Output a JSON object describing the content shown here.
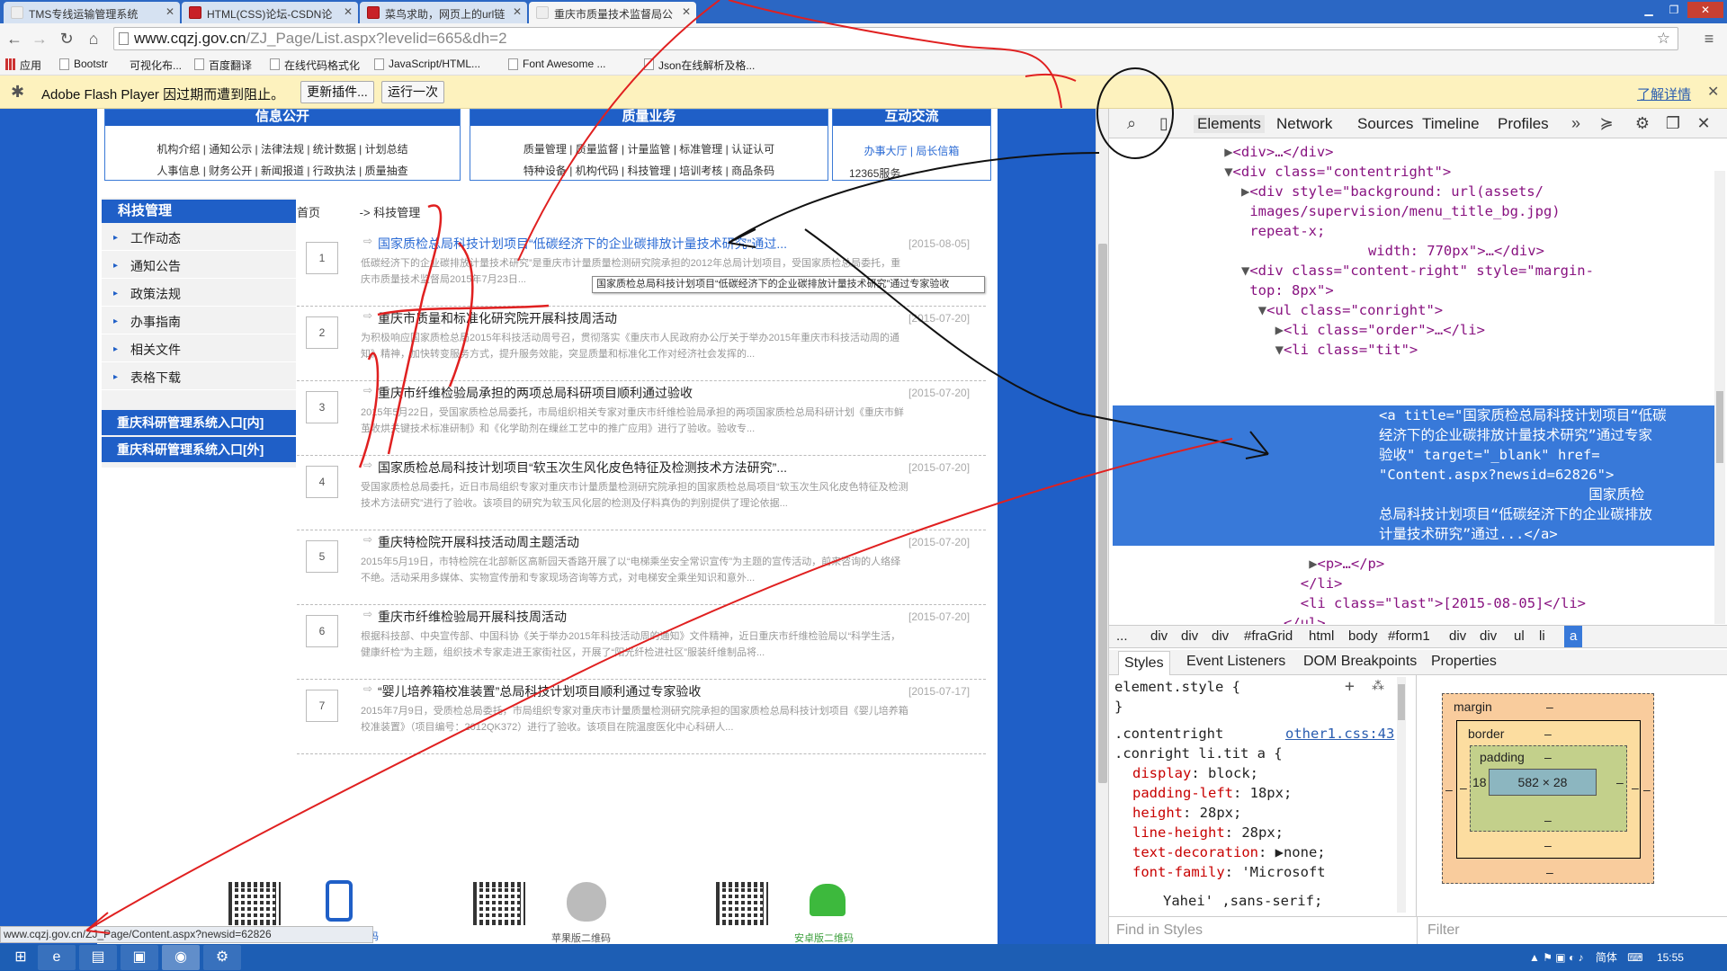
{
  "tabs": [
    {
      "label": "TMS专线运输管理系统",
      "favicon": "page"
    },
    {
      "label": "HTML(CSS)论坛-CSDN论",
      "favicon": "csdn"
    },
    {
      "label": "菜鸟求助，网页上的url链",
      "favicon": "csdn"
    },
    {
      "label": "重庆市质量技术监督局公",
      "favicon": "page"
    }
  ],
  "address": {
    "host": "www.cqzj.gov.cn",
    "path": "/ZJ_Page/List.aspx?levelid=665&dh=2"
  },
  "bookmarks": [
    "应用",
    "Bootstr",
    "可视化布...",
    "百度翻译",
    "在线代码格式化",
    "JavaScript/HTML...",
    "Font Awesome ...",
    "Json在线解析及格..."
  ],
  "flash": {
    "message": "Adobe Flash Player 因过期而遭到阻止。",
    "update_label": "更新插件...",
    "run_label": "运行一次",
    "details_label": "了解详情"
  },
  "page": {
    "boxes": [
      {
        "title": "信息公开",
        "row1": "机构介绍 | 通知公示 | 法律法规 | 统计数据 | 计划总结",
        "row2": "人事信息 | 财务公开 | 新闻报道 | 行政执法 | 质量抽查"
      },
      {
        "title": "质量业务",
        "row1": "质量管理 | 质量监督 | 计量监管 | 标准管理 | 认证认可",
        "row2": "特种设备 | 机构代码 | 科技管理 | 培训考核 | 商品条码"
      },
      {
        "title": "互动交流",
        "row1": "办事大厅 | 局长信箱",
        "row2": "12365服务"
      }
    ],
    "sidebar": {
      "title": "科技管理",
      "items": [
        "工作动态",
        "通知公告",
        "政策法规",
        "办事指南",
        "相关文件",
        "表格下载"
      ],
      "links": [
        "重庆科研管理系统入口[内]",
        "重庆科研管理系统入口[外]"
      ]
    },
    "breadcrumb": {
      "home": "首页",
      "sep": "->",
      "current": "科技管理"
    },
    "articles": [
      {
        "num": "1",
        "title": "国家质检总局科技计划项目“低碳经济下的企业碳排放计量技术研究”通过...",
        "date": "[2015-08-05]",
        "desc": "低碳经济下的企业碳排放计量技术研究”是重庆市计量质量检测研究院承担的2012年总局计划项目，受国家质检总局委托，重庆市质量技术监督局2015年7月23日..."
      },
      {
        "num": "2",
        "title": "重庆市质量和标准化研究院开展科技周活动",
        "date": "[2015-07-20]",
        "desc": "为积极响应国家质检总局2015年科技活动周号召，贯彻落实《重庆市人民政府办公厅关于举办2015年重庆市科技活动周的通知》精神，加快转变服务方式，提升服务效能，突显质量和标准化工作对经济社会发挥的..."
      },
      {
        "num": "3",
        "title": "重庆市纤维检验局承担的两项总局科研项目顺利通过验收",
        "date": "[2015-07-20]",
        "desc": "2015年5月22日，受国家质检总局委托，市局组织相关专家对重庆市纤维检验局承担的两项国家质检总局科研计划《重庆市鲜茧收烘关键技术标准研制》和《化学助剂在缫丝工艺中的推广应用》进行了验收。验收专..."
      },
      {
        "num": "4",
        "title": "国家质检总局科技计划项目“软玉次生风化皮色特征及检测技术方法研究”...",
        "date": "[2015-07-20]",
        "desc": "受国家质检总局委托，近日市局组织专家对重庆市计量质量检测研究院承担的国家质检总局项目“软玉次生风化皮色特征及检测技术方法研究”进行了验收。该项目的研究为软玉风化层的检测及仔料真伪的判别提供了理论依据..."
      },
      {
        "num": "5",
        "title": "重庆特检院开展科技活动周主题活动",
        "date": "[2015-07-20]",
        "desc": "2015年5月19日，市特检院在北部新区高新园天香路开展了以“电梯乘坐安全常识宣传”为主题的宣传活动，前来咨询的人络绎不绝。活动采用多媒体、实物宣传册和专家现场咨询等方式，对电梯安全乘坐知识和意外..."
      },
      {
        "num": "6",
        "title": "重庆市纤维检验局开展科技周活动",
        "date": "[2015-07-20]",
        "desc": "根据科技部、中央宣传部、中国科协《关于举办2015年科技活动周的通知》文件精神，近日重庆市纤维检验局以“科学生活，健康纤检”为主题，组织技术专家走进王家街社区，开展了“阳光纤检进社区”服装纤维制品将..."
      },
      {
        "num": "7",
        "title": "“婴儿培养箱校准装置”总局科技计划项目顺利通过专家验收",
        "date": "[2015-07-17]",
        "desc": "2015年7月9日，受质检总局委托，市局组织专家对重庆市计量质量检测研究院承担的国家质检总局科技计划项目《婴儿培养箱校准装置》（项目编号：2012QK372）进行了验收。该项目在院温度医化中心科研人..."
      }
    ],
    "tooltip": "国家质检总局科技计划项目“低碳经济下的企业碳排放计量技术研究”通过专家验收",
    "footer": {
      "apple_label": "苹果版二维码",
      "android_label": "安卓版二维码",
      "partial_label": "码"
    },
    "status_url": "www.cqzj.gov.cn/ZJ_Page/Content.aspx?newsid=62826"
  },
  "devtools": {
    "tabs": [
      "Elements",
      "Network",
      "Sources",
      "Timeline",
      "Profiles"
    ],
    "dom_lines": [
      {
        "indent": 13,
        "tri": "▶",
        "html": "<div>…</div>"
      },
      {
        "indent": 13,
        "tri": "▼",
        "html": "<div class=\"contentright\">"
      },
      {
        "indent": 15,
        "tri": "▶",
        "html": "<div style=\"background: url(assets/"
      },
      {
        "indent": 15,
        "tri": "",
        "html": "images/supervision/menu_title_bg.jpg)"
      },
      {
        "indent": 15,
        "tri": "",
        "html": "repeat-x;"
      },
      {
        "indent": 29,
        "tri": "",
        "html": "width: 770px\">…</div>"
      },
      {
        "indent": 15,
        "tri": "▼",
        "html": "<div class=\"content-right\" style=\"margin-"
      },
      {
        "indent": 15,
        "tri": "",
        "html": "top: 8px\">"
      },
      {
        "indent": 17,
        "tri": "▼",
        "html": "<ul class=\"conright\">"
      },
      {
        "indent": 19,
        "tri": "▶",
        "html": "<li class=\"order\">…</li>"
      },
      {
        "indent": 19,
        "tri": "▼",
        "html": "<li class=\"tit\">"
      }
    ],
    "dom_selected": "<a title=\"国家质检总局科技计划项目“低碳\n经济下的企业碳排放计量技术研究”通过专家\n验收\" target=\"_blank\" href=\n\"Content.aspx?newsid=62826\">\n                         国家质检\n总局科技计划项目“低碳经济下的企业碳排放\n计量技术研究”通过...</a>",
    "dom_after": [
      {
        "indent": 23,
        "tri": "▶",
        "html": "<p>…</p>"
      },
      {
        "indent": 21,
        "tri": "",
        "html": "</li>"
      },
      {
        "indent": 21,
        "tri": "",
        "html": "<li class=\"last\">[2015-08-05]</li>"
      },
      {
        "indent": 19,
        "tri": "",
        "html": "</ul>"
      },
      {
        "indent": 17,
        "tri": "▶",
        "html": "<ul class=\"conright\">…</ul>"
      }
    ],
    "crumbs": [
      "...",
      "div",
      "div",
      "div",
      "#fraGrid",
      "html",
      "body",
      "#form1",
      "div",
      "div",
      "ul",
      "li",
      "a"
    ],
    "subtabs": [
      "Styles",
      "Event Listeners",
      "DOM Breakpoints",
      "Properties"
    ],
    "styles": {
      "element_style": "element.style {",
      "close": "}",
      "selector1": ".contentright",
      "link": "other1.css:43",
      "selector2": ".conright li.tit a {",
      "props": [
        {
          "name": "display",
          "value": "block;"
        },
        {
          "name": "padding-left",
          "value": "18px;"
        },
        {
          "name": "height",
          "value": "28px;"
        },
        {
          "name": "line-height",
          "value": "28px;"
        },
        {
          "name": "text-decoration",
          "value": "▶none;"
        },
        {
          "name": "font-family",
          "value": "'Microsoft"
        }
      ],
      "cont": "Yahei' ,sans-serif;",
      "find_placeholder": "Find in Styles",
      "filter_placeholder": "Filter"
    },
    "boxmodel": {
      "margin_label": "margin",
      "border_label": "border",
      "padding_label": "padding",
      "dash": "–",
      "padding_left": "18",
      "content": "582 × 28"
    }
  },
  "taskbar": {
    "lang": "简体",
    "time": "15:55"
  }
}
